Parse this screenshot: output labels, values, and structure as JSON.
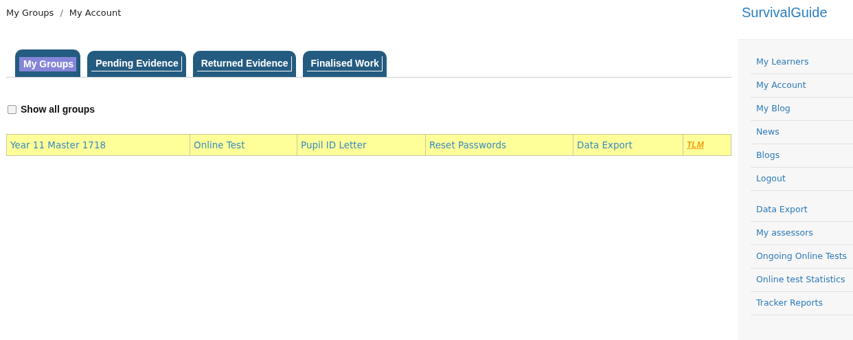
{
  "breadcrumb": {
    "items": [
      "My Groups",
      "My Account"
    ],
    "separator": "/"
  },
  "tabs": [
    {
      "label": "My Groups",
      "selected": true
    },
    {
      "label": "Pending Evidence",
      "selected": false
    },
    {
      "label": "Returned Evidence",
      "selected": false
    },
    {
      "label": "Finalised Work",
      "selected": false
    }
  ],
  "show_all_groups": {
    "label": "Show all groups",
    "checked": false
  },
  "group_row": [
    {
      "kind": "link",
      "text": "Year 11 Master 1718"
    },
    {
      "kind": "link",
      "text": "Online Test"
    },
    {
      "kind": "link",
      "text": "Pupil ID Letter"
    },
    {
      "kind": "link",
      "text": "Reset Passwords"
    },
    {
      "kind": "link",
      "text": "Data Export"
    },
    {
      "kind": "logo",
      "text": "TLM"
    }
  ],
  "sidebar": {
    "title": "SurvivalGuide",
    "groups": [
      [
        "My Learners",
        "My Account",
        "My Blog",
        "News",
        "Blogs",
        "Logout"
      ],
      [
        "Data Export",
        "My assessors",
        "Ongoing Online Tests",
        "Online test Statistics",
        "Tracker Reports"
      ]
    ]
  }
}
